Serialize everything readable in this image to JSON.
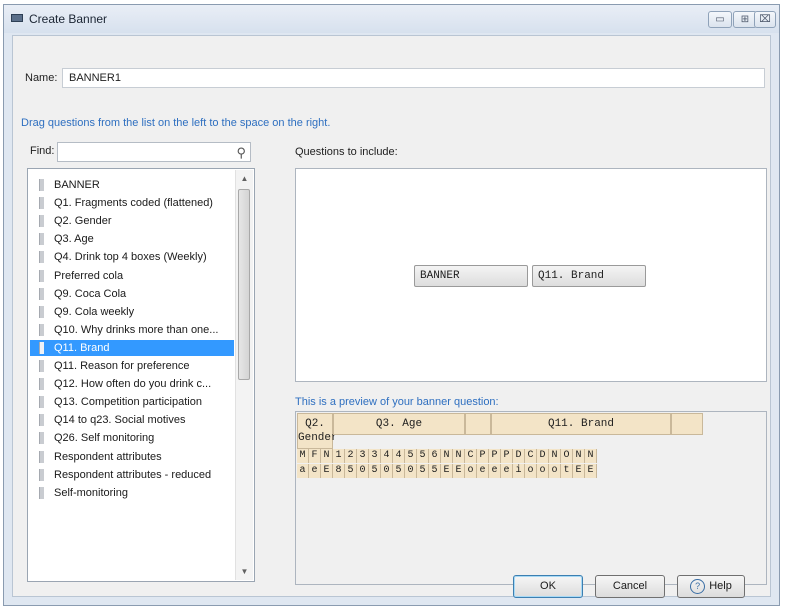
{
  "window": {
    "title": "Create Banner",
    "minimize": "▭",
    "maximize": "⊞",
    "close": "⌧"
  },
  "name_field": {
    "label": "Name:",
    "value": "BANNER1"
  },
  "hint": "Drag questions from the list on the left to the space on the right.",
  "find": {
    "label": "Find:",
    "value": "",
    "icon": "search-icon"
  },
  "question_list": [
    "BANNER",
    "Q1. Fragments coded (flattened)",
    "Q2. Gender",
    "Q3. Age",
    "Q4. Drink top 4 boxes (Weekly)",
    "Preferred cola",
    "Q9. Coca Cola",
    "Q9. Cola weekly",
    "Q10. Why drinks more than one...",
    "Q11. Brand",
    "Q11. Reason for preference",
    "Q12. How often do you drink c...",
    "Q13. Competition participation",
    "Q14 to q23. Social motives",
    "Q26. Self monitoring",
    "Respondent attributes",
    "Respondent attributes - reduced",
    "Self-monitoring"
  ],
  "selected_question": "Q11. Brand",
  "include_label": "Questions to include:",
  "included": [
    "BANNER",
    "Q11. Brand"
  ],
  "preview": {
    "label": "This is a preview of your banner question:",
    "groups": [
      "Q2. Gender",
      "Q3. Age",
      "Q11. Brand"
    ],
    "row1": [
      "M",
      "F",
      "N",
      "1",
      "2",
      "3",
      "3",
      "4",
      "4",
      "5",
      "5",
      "6",
      "N",
      "N",
      "C",
      "P",
      "P",
      "P",
      "D",
      "C",
      "D",
      "N",
      "O",
      "N",
      "N"
    ],
    "row2": [
      "a",
      "e",
      "E",
      "8",
      "5",
      "0",
      "5",
      "0",
      "5",
      "0",
      "5",
      "5",
      "E",
      "E",
      "o",
      "e",
      "e",
      "e",
      "i",
      "o",
      "o",
      "o",
      "t",
      "E",
      "E"
    ]
  },
  "buttons": {
    "ok": "OK",
    "cancel": "Cancel",
    "help": "Help",
    "help_icon": "?"
  }
}
